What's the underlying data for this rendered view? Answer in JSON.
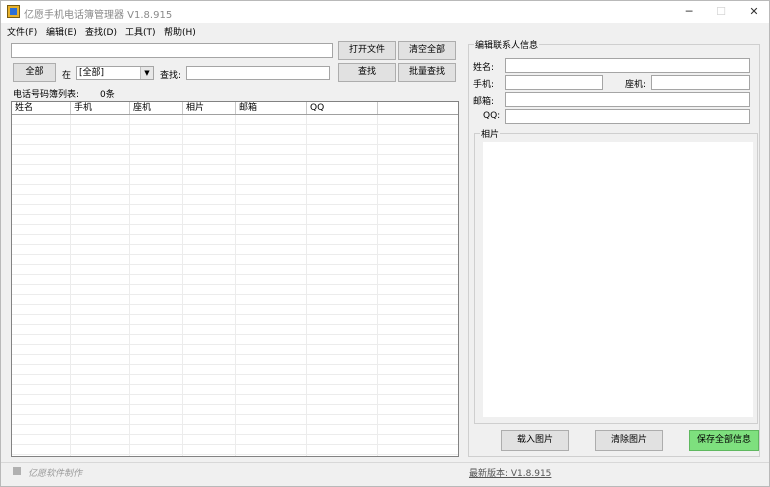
{
  "window": {
    "title": "亿愿手机电话簿管理器 V1.8.915",
    "controls": [
      "─",
      "☐",
      "✕"
    ]
  },
  "menu": [
    "文件(F)",
    "编辑(E)",
    "查找(D)",
    "工具(T)",
    "帮助(H)"
  ],
  "toolbar": {
    "file_path_value": "",
    "open_file": "打开文件",
    "clear_all": "清空全部",
    "all_button": "全部",
    "in_label": "在",
    "scope_value": "[全部]",
    "search_label": "查找:",
    "search_value": "",
    "search_button": "查找",
    "batch_search_button": "批量查找"
  },
  "list": {
    "title": "电话号码簿列表:",
    "count": "0条",
    "columns": [
      "姓名",
      "手机",
      "座机",
      "相片",
      "邮箱",
      "QQ"
    ]
  },
  "editor": {
    "group_title": "编辑联系人信息",
    "name_label": "姓名:",
    "mobile_label": "手机:",
    "phone_label": "座机:",
    "email_label": "邮箱:",
    "qq_label": "QQ:",
    "name_value": "",
    "mobile_value": "",
    "phone_value": "",
    "email_value": "",
    "qq_value": "",
    "photo_group_title": "相片",
    "load_photo": "载入图片",
    "clear_photo": "清除图片",
    "save_all": "保存全部信息",
    "save_color": "#7ee07e"
  },
  "status": {
    "left": "亿愿软件制作",
    "right": "最新版本: V1.8.915"
  }
}
